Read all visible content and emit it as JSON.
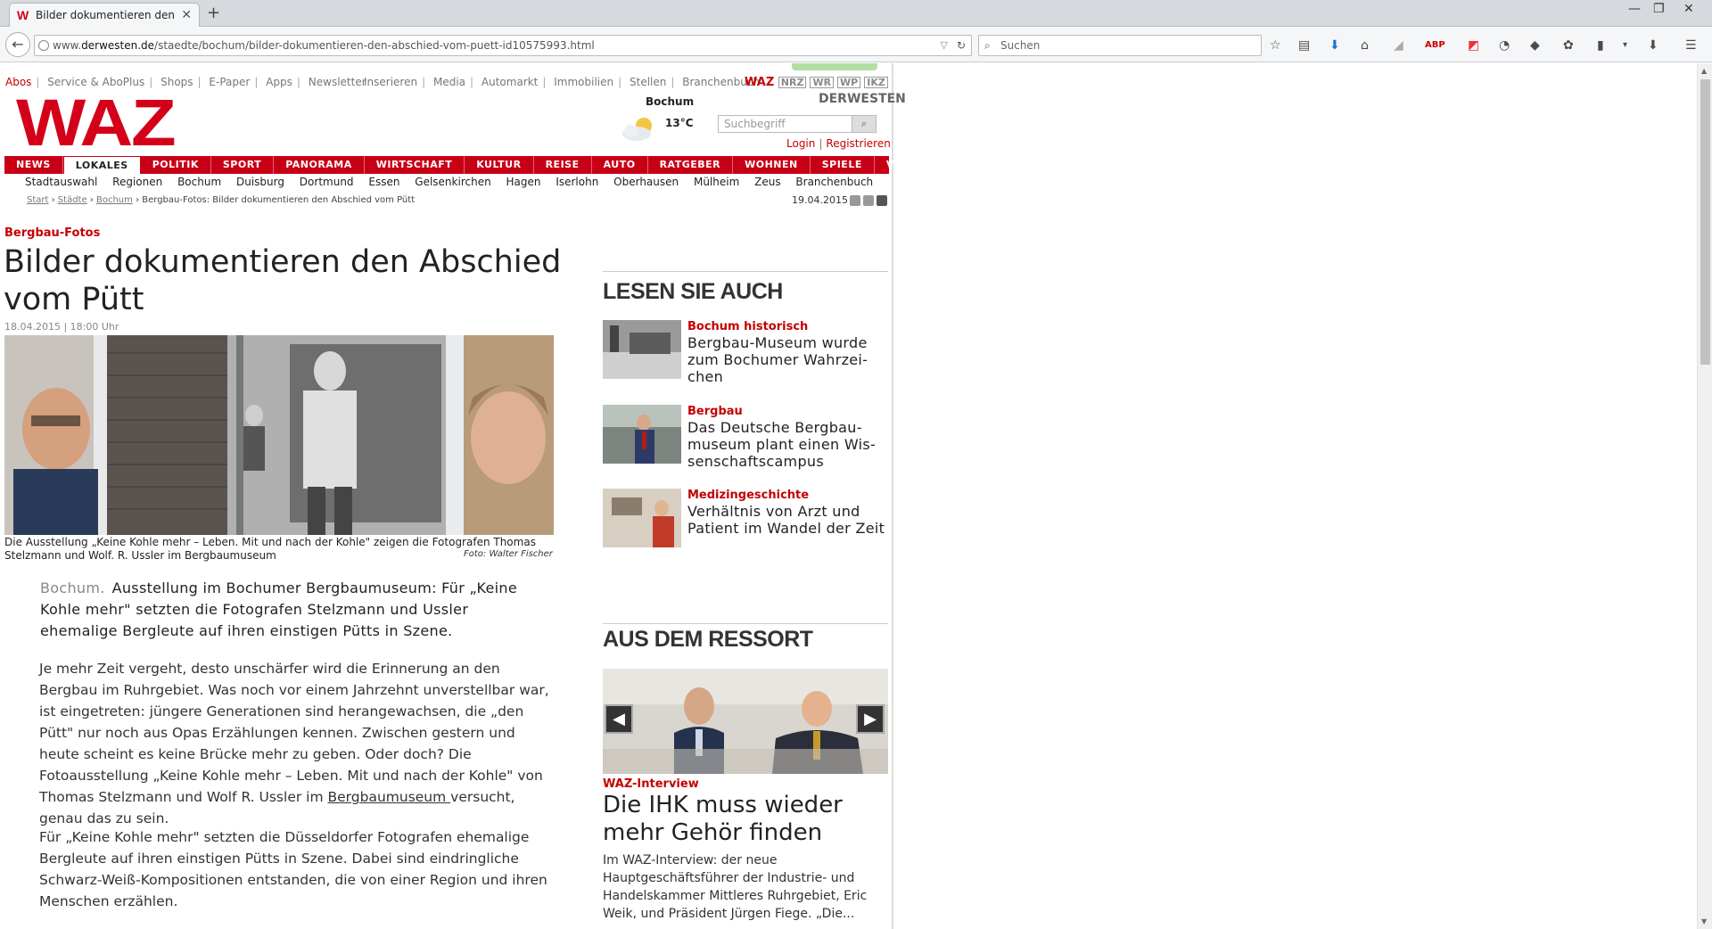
{
  "browser": {
    "tab_title": "Bilder dokumentieren den ...",
    "url_prefix": "www.",
    "url_host": "derwesten.de",
    "url_path": "/staedte/bochum/bilder-dokumentieren-den-abschied-vom-puett-id10575993.html",
    "search_placeholder": "Suchen"
  },
  "site": {
    "logo": "WAZ",
    "top_links_left": [
      "Abos",
      "Service & AboPlus",
      "Shops",
      "E-Paper",
      "Apps",
      "Newsletter"
    ],
    "top_links_right": [
      "Inserieren",
      "Media",
      "Automarkt",
      "Immobilien",
      "Stellen",
      "Branchenbuch"
    ],
    "brands": [
      "WAZ",
      "NRZ",
      "WR",
      "WP",
      "IKZ"
    ],
    "derwesten": "DERWESTEN",
    "weather_city": "Bochum",
    "weather_temp": "13°C",
    "search_placeholder": "Suchbegriff",
    "login": "Login",
    "register": "Registrieren",
    "nav": [
      "NEWS",
      "LOKALES",
      "POLITIK",
      "SPORT",
      "PANORAMA",
      "WIRTSCHAFT",
      "KULTUR",
      "REISE",
      "AUTO",
      "RATGEBER",
      "WOHNEN",
      "SPIELE",
      "VIDEOS"
    ],
    "nav_active": "LOKALES",
    "subnav": [
      "Stadtauswahl",
      "Regionen",
      "Bochum",
      "Duisburg",
      "Dortmund",
      "Essen",
      "Gelsenkirchen",
      "Hagen",
      "Iserlohn",
      "Oberhausen",
      "Mülheim",
      "Zeus",
      "Branchenbuch"
    ],
    "breadcrumb": [
      "Start",
      "Städte",
      "Bochum"
    ],
    "breadcrumb_current": "Bergbau-Fotos: Bilder dokumentieren den Abschied vom Pütt",
    "date": "19.04.2015"
  },
  "article": {
    "kicker": "Bergbau-Fotos",
    "headline": "Bilder dokumentieren den Abschied vom Pütt",
    "meta": "18.04.2015 | 18:00 Uhr",
    "caption": "Die Ausstellung „Keine Kohle mehr – Leben. Mit und nach der Kohle\" zeigen die Fotografen Thomas Stelzmann und Wolf. R. Ussler im Bergbaumuseum",
    "credit": "Foto: Walter Fischer",
    "lead_city": "Bochum.",
    "lead": "Ausstellung im Bochumer Bergbaumuseum: Für „Keine Kohle mehr\" setzten die Fotografen Stelzmann und Ussler ehemalige Bergleute auf ihren einstigen Pütts in Szene.",
    "para1_before": "Je mehr Zeit vergeht, desto unschärfer wird die Erinnerung an den Bergbau im Ruhrgebiet. Was noch vor einem Jahrzehnt unverstellbar war, ist einge­treten: jüngere Generationen sind herangewachsen, die „den Pütt\" nur noch aus Opas Erzählungen kennen. Zwischen gestern und heute scheint es keine Brücke mehr zu geben. Oder doch? Die Fotoausstellung „Keine Kohle mehr – Leben. Mit und nach der Kohle\" von Thomas Stelzmann und Wolf R. Ussler im ",
    "para1_link": "Bergbaumuseum ",
    "para1_after": "versucht, genau das zu sein.",
    "para2": "Für „Keine Kohle mehr\" setzten die Düsseldorfer Fotografen ehemalige Bergleute auf ihren einstigen Pütts in Szene. Dabei sind eindringliche Schwarz-Weiß-Kompositionen entstanden, die von einer Region und ihren Menschen erzählen."
  },
  "sidebar": {
    "lesen_heading": "LESEN SIE AUCH",
    "teasers": [
      {
        "kicker": "Bochum historisch",
        "title": "Bergbau-Museum wurde zum Bochumer Wahrzei­chen"
      },
      {
        "kicker": "Bergbau",
        "title": "Das Deutsche Bergbau­museum plant einen Wis­senschaftscampus"
      },
      {
        "kicker": "Medizingeschichte",
        "title": "Verhältnis von Arzt und Patient im Wandel der Zeit"
      }
    ],
    "ressort_heading": "AUS DEM RESSORT",
    "ressort_kicker": "WAZ-Interview",
    "ressort_title": "Die IHK muss wieder mehr Gehör finden",
    "ressort_teaser": "Im WAZ-Interview: der neue Hauptgeschäftsführer der Industrie- und Handelskammer Mittleres Ruhrgebiet, Eric Weik, und Präsident Jürgen Fiege. „Die..."
  },
  "colors": {
    "brand_red": "#c80016",
    "kicker_red": "#c40000"
  }
}
